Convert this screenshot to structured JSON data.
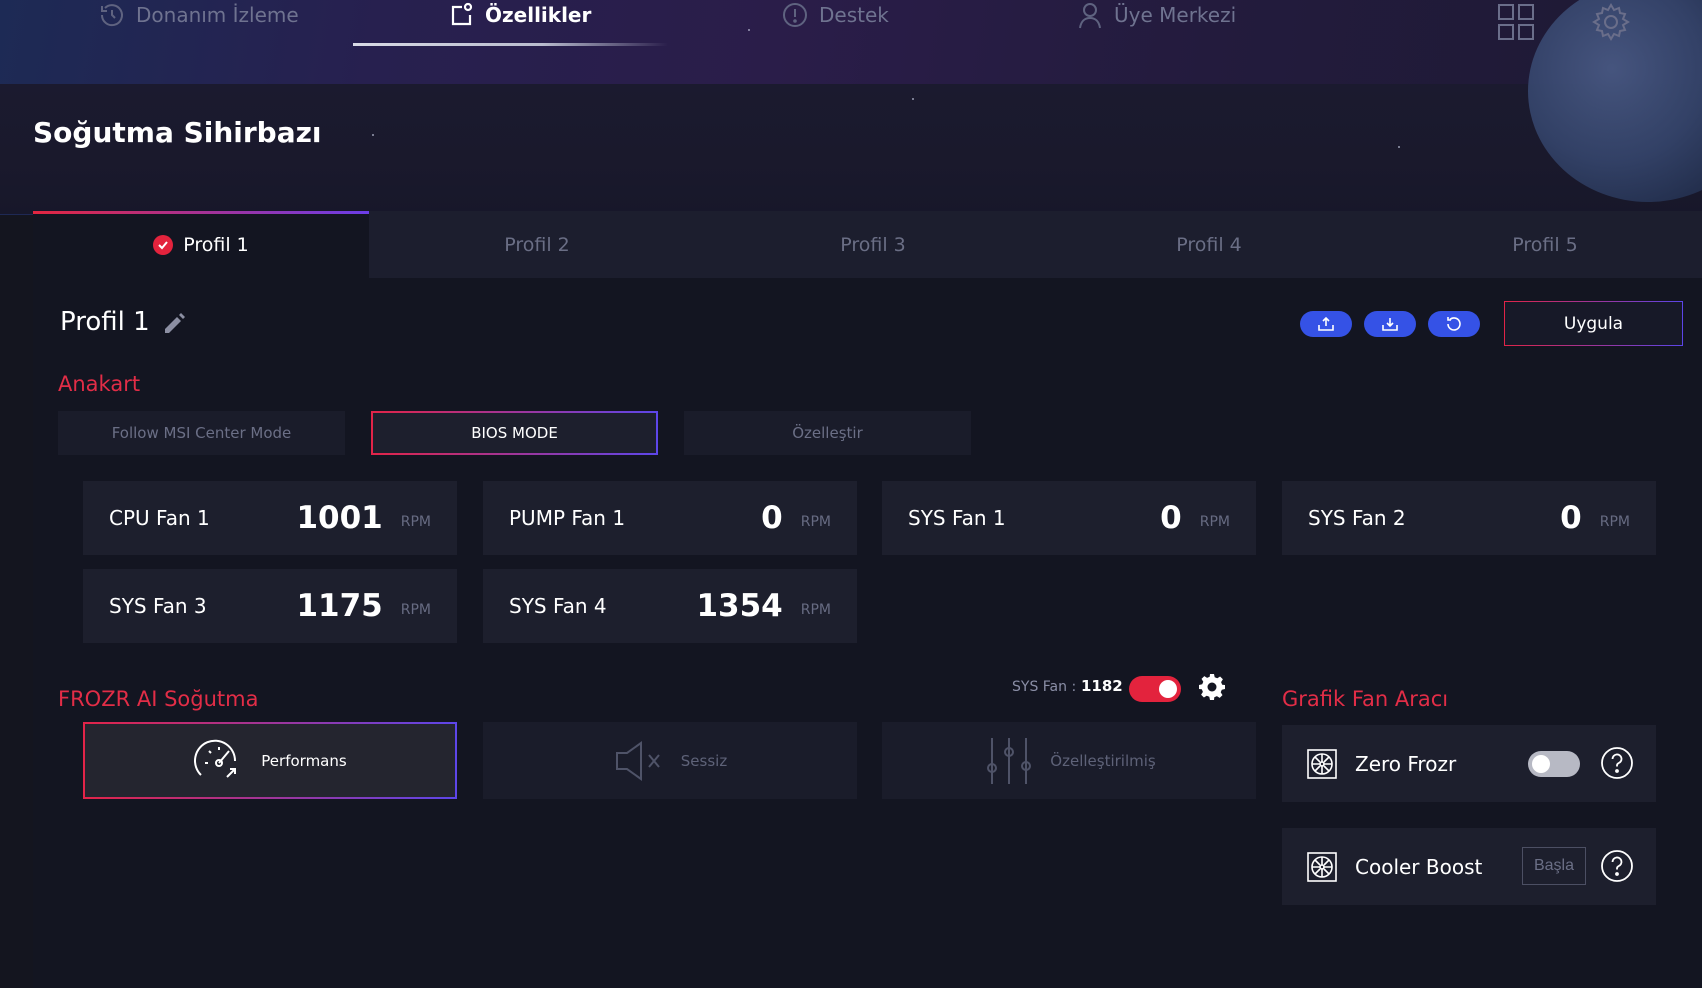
{
  "nav": {
    "items": [
      {
        "label": "Donanım İzleme",
        "icon": "hardware-monitor-icon"
      },
      {
        "label": "Özellikler",
        "icon": "features-icon"
      },
      {
        "label": "Destek",
        "icon": "support-icon"
      },
      {
        "label": "Üye Merkezi",
        "icon": "member-icon"
      }
    ],
    "active_index": 1
  },
  "page_title": "Soğutma Sihirbazı",
  "tabs": [
    {
      "label": "Profil 1",
      "active": true
    },
    {
      "label": "Profil 2",
      "active": false
    },
    {
      "label": "Profil 3",
      "active": false
    },
    {
      "label": "Profil 4",
      "active": false
    },
    {
      "label": "Profil 5",
      "active": false
    }
  ],
  "profile": {
    "name": "Profil 1",
    "apply_label": "Uygula"
  },
  "motherboard": {
    "section_label": "Anakart",
    "modes": [
      {
        "label": "Follow MSI Center Mode",
        "active": false
      },
      {
        "label": "BIOS MODE",
        "active": true
      },
      {
        "label": "Özelleştir",
        "active": false
      }
    ],
    "fans": [
      {
        "name": "CPU Fan 1",
        "value": "1001",
        "unit": "RPM"
      },
      {
        "name": "PUMP Fan 1",
        "value": "0",
        "unit": "RPM"
      },
      {
        "name": "SYS Fan 1",
        "value": "0",
        "unit": "RPM"
      },
      {
        "name": "SYS Fan 2",
        "value": "0",
        "unit": "RPM"
      },
      {
        "name": "SYS Fan 3",
        "value": "1175",
        "unit": "RPM"
      },
      {
        "name": "SYS Fan 4",
        "value": "1354",
        "unit": "RPM"
      }
    ]
  },
  "frozr": {
    "section_label": "FROZR AI Soğutma",
    "sysfan_label": "SYS Fan :",
    "sysfan_value": "1182",
    "toggle_on": true,
    "modes": [
      {
        "label": "Performans",
        "active": true
      },
      {
        "label": "Sessiz",
        "active": false
      },
      {
        "label": "Özelleştirilmiş",
        "active": false
      }
    ]
  },
  "graphics_fan": {
    "section_label": "Grafik Fan Aracı",
    "zero_frozr_label": "Zero Frozr",
    "zero_frozr_on": false,
    "cooler_boost_label": "Cooler Boost",
    "start_label": "Başla"
  },
  "colors": {
    "accent_red": "#e22d47",
    "accent_blue": "#3552e6",
    "card_bg": "#1d1f2d"
  }
}
